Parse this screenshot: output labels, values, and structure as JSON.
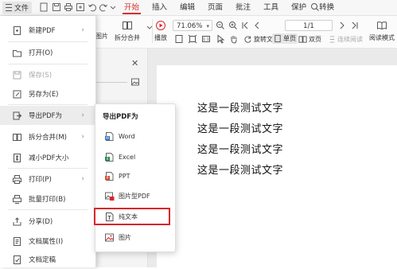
{
  "menubar": {
    "file_label": "文件",
    "tabs": [
      {
        "label": "开始",
        "active": true
      },
      {
        "label": "插入",
        "active": false
      },
      {
        "label": "编辑",
        "active": false
      },
      {
        "label": "页面",
        "active": false
      },
      {
        "label": "批注",
        "active": false
      },
      {
        "label": "工具",
        "active": false
      },
      {
        "label": "保护",
        "active": false
      },
      {
        "label": "转换",
        "active": false
      }
    ]
  },
  "toolbar": {
    "partial_label_1": "图片",
    "split_merge": "拆分合并",
    "play": "播放",
    "zoom_value": "71.06%",
    "page_value": "1/1",
    "rotate_doc": "旋转文档",
    "single_page": "单页",
    "double_page": "双页",
    "continuous_read": "连续阅读",
    "read_mode": "阅读模式"
  },
  "file_menu": {
    "items": [
      {
        "label": "新建PDF",
        "icon": "new-pdf-icon",
        "arrow": true,
        "disabled": false
      },
      {
        "label": "打开(O)",
        "icon": "open-folder-icon",
        "arrow": false,
        "disabled": false
      },
      {
        "label": "保存(S)",
        "icon": "save-icon",
        "arrow": false,
        "disabled": true
      },
      {
        "label": "另存为(E)",
        "icon": "save-as-icon",
        "arrow": false,
        "disabled": false
      },
      {
        "label": "导出PDF为",
        "icon": "export-icon",
        "arrow": true,
        "disabled": false,
        "hover": true
      },
      {
        "label": "拆分合并(M)",
        "icon": "split-merge-icon",
        "arrow": true,
        "disabled": false
      },
      {
        "label": "减小PDF大小",
        "icon": "compress-icon",
        "arrow": false,
        "disabled": false
      },
      {
        "label": "打印(P)",
        "icon": "print-icon",
        "arrow": true,
        "disabled": false
      },
      {
        "label": "批量打印(B)",
        "icon": "batch-print-icon",
        "arrow": false,
        "disabled": false
      },
      {
        "label": "分享(D)",
        "icon": "share-icon",
        "arrow": false,
        "disabled": false
      },
      {
        "label": "文档属性(I)",
        "icon": "doc-properties-icon",
        "arrow": false,
        "disabled": false
      },
      {
        "label": "文档定稿",
        "icon": "finalize-icon",
        "arrow": false,
        "disabled": false
      }
    ]
  },
  "export_menu": {
    "title": "导出PDF为",
    "items": [
      {
        "label": "Word",
        "icon": "word-file-icon",
        "color": "#2b6fc2"
      },
      {
        "label": "Excel",
        "icon": "excel-file-icon",
        "color": "#1f8a4c"
      },
      {
        "label": "PPT",
        "icon": "ppt-file-icon",
        "color": "#d2522e"
      },
      {
        "label": "图片型PDF",
        "icon": "image-pdf-icon",
        "color": "#d9262b"
      },
      {
        "label": "纯文本",
        "icon": "plain-text-icon",
        "color": "#555555",
        "highlighted": true
      },
      {
        "label": "图片",
        "icon": "image-icon",
        "color": "#d9262b"
      }
    ]
  },
  "document": {
    "lines": [
      "这是一段测试文字",
      "这是一段测试文字",
      "这是一段测试文字",
      "这是一段测试文字"
    ]
  },
  "colors": {
    "accent": "#d42f2f",
    "highlight_border": "#d9262b"
  }
}
